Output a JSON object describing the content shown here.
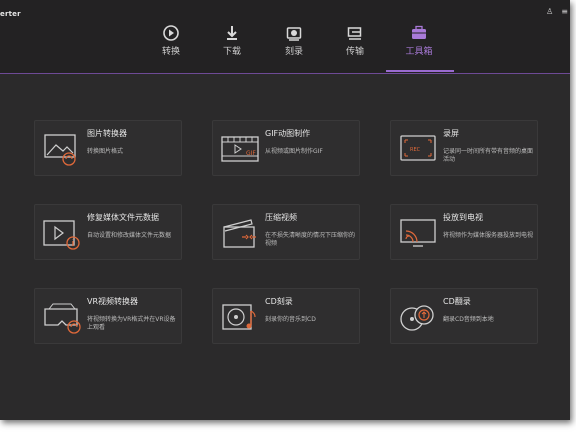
{
  "app": {
    "title": "erter"
  },
  "window_controls": [
    {
      "name": "account-icon",
      "glyph": "♙"
    },
    {
      "name": "menu-icon",
      "glyph": "≡"
    }
  ],
  "nav": {
    "tabs": [
      {
        "label": "转换",
        "icon": "convert-icon"
      },
      {
        "label": "下载",
        "icon": "download-icon"
      },
      {
        "label": "刻录",
        "icon": "burn-icon"
      },
      {
        "label": "传输",
        "icon": "transfer-icon"
      },
      {
        "label": "工具箱",
        "icon": "toolbox-icon",
        "active": true
      }
    ]
  },
  "tools": [
    {
      "title": "图片转换器",
      "desc": "转换图片格式",
      "icon": "image-convert-icon"
    },
    {
      "title": "GIF动图制作",
      "desc": "从视频或图片制作GIF",
      "icon": "gif-maker-icon"
    },
    {
      "title": "录屏",
      "desc": "记录同一时间所有带有音频的桌面活动",
      "icon": "screen-record-icon"
    },
    {
      "title": "修复媒体文件元数据",
      "desc": "自动设置和修改媒体文件元数据",
      "icon": "metadata-icon"
    },
    {
      "title": "压缩视频",
      "desc": "在不损失清晰度的情况下压缩你的视频",
      "icon": "compress-icon"
    },
    {
      "title": "投放到电视",
      "desc": "将视频作为媒体服务器投放到电视",
      "icon": "cast-tv-icon"
    },
    {
      "title": "VR视频转换器",
      "desc": "将视频转换为VR格式并在VR设备上观看",
      "icon": "vr-convert-icon"
    },
    {
      "title": "CD刻录",
      "desc": "刻录你的音乐到CD",
      "icon": "cd-burn-icon"
    },
    {
      "title": "CD翻录",
      "desc": "翻录CD音频到本地",
      "icon": "cd-rip-icon"
    }
  ],
  "colors": {
    "accent": "#9a6bd0",
    "orange": "#e0693a",
    "window_bg": "#2b2a2b",
    "card_bg": "#2f2e2f"
  }
}
